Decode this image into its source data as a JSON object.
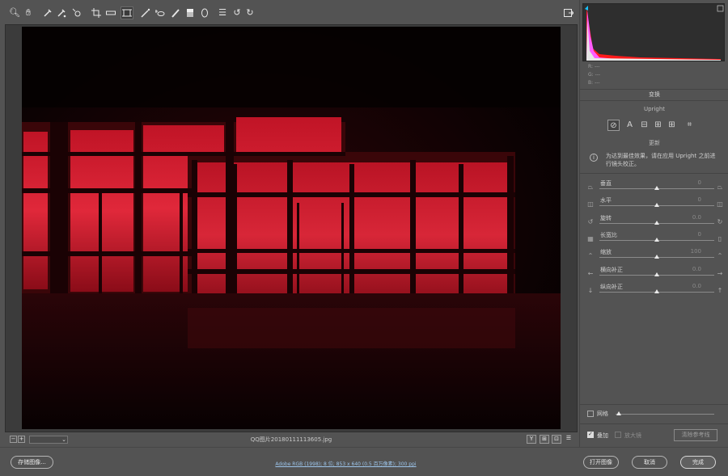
{
  "toolbar": {
    "tools": [
      "zoom-icon",
      "hand-icon",
      "white-balance-icon",
      "color-sampler-icon",
      "targeted-adjustment-icon",
      "crop-icon",
      "straighten-icon",
      "transform-icon",
      "spot-removal-icon",
      "red-eye-icon",
      "adjustment-brush-icon",
      "graduated-filter-icon",
      "radial-filter-icon",
      "presets-icon",
      "rotate-ccw-icon",
      "rotate-cw-icon"
    ],
    "active_tool": "transform-icon"
  },
  "image": {
    "filename": "QQ图片20180111113605.jpg"
  },
  "histogram": {
    "r_label": "R:",
    "g_label": "G:",
    "b_label": "B:",
    "r_value": "---",
    "g_value": "---",
    "b_value": "---"
  },
  "transform_panel": {
    "title": "变换",
    "upright_label": "Upright",
    "upright_buttons": [
      "off",
      "auto",
      "level",
      "vertical",
      "full",
      "guided"
    ],
    "upright_glyphs": [
      "⊘",
      "A",
      "⊟",
      "⊞",
      "⊞",
      "⌗"
    ],
    "update_label": "更新",
    "info_text": "为达到最佳效果，请在应用 Upright 之前进行镜头校正。",
    "sliders": [
      {
        "label": "垂直",
        "value": "0",
        "position": 0.5
      },
      {
        "label": "水平",
        "value": "0",
        "position": 0.5
      },
      {
        "label": "旋转",
        "value": "0.0",
        "position": 0.5
      },
      {
        "label": "长宽比",
        "value": "0",
        "position": 0.5
      },
      {
        "label": "缩放",
        "value": "100",
        "position": 0.5
      },
      {
        "label": "横向补正",
        "value": "0.0",
        "position": 0.5
      },
      {
        "label": "纵向补正",
        "value": "0.0",
        "position": 0.5
      }
    ],
    "grid_label": "网格",
    "overlay_label": "叠加",
    "magnifier_label": "放大镜",
    "clear_guides_label": "清除参考线"
  },
  "bottom_bar": {
    "save_label": "存储图像...",
    "workflow_link": "Adobe RGB (1998); 8 位; 853 x 640 (0.5 百万像素); 300 ppi",
    "open_label": "打开图像",
    "cancel_label": "取消",
    "done_label": "完成"
  },
  "status_buttons": [
    "Y",
    "⊞",
    "⊡",
    "☰"
  ],
  "colors": {
    "background": "#535353",
    "photo_red": "#e02838",
    "histogram_red": "#ff1a1a",
    "histogram_magenta": "#ff5cff"
  }
}
